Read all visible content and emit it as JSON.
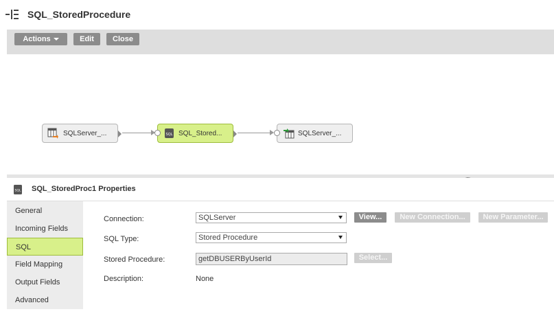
{
  "header": {
    "title": "SQL_StoredProcedure"
  },
  "toolbar": {
    "actions_label": "Actions",
    "edit_label": "Edit",
    "close_label": "Close"
  },
  "canvas": {
    "nodes": [
      {
        "label": "SQLServer_...",
        "icon": "source-table-icon"
      },
      {
        "label": "SQL_Stored...",
        "icon": "sql-database-icon"
      },
      {
        "label": "SQLServer_...",
        "icon": "target-table-icon"
      }
    ],
    "splitter_grip": "....."
  },
  "properties": {
    "title": "SQL_StoredProc1 Properties",
    "icon": "sql-database-icon",
    "tabs": [
      {
        "label": "General"
      },
      {
        "label": "Incoming Fields"
      },
      {
        "label": "SQL",
        "active": true
      },
      {
        "label": "Field Mapping"
      },
      {
        "label": "Output Fields"
      },
      {
        "label": "Advanced"
      }
    ],
    "form": {
      "connection_label": "Connection:",
      "connection_value": "SQLServer",
      "view_button": "View...",
      "new_connection_button": "New Connection...",
      "new_parameter_button": "New Parameter...",
      "sql_type_label": "SQL Type:",
      "sql_type_value": "Stored Procedure",
      "stored_procedure_label": "Stored Procedure:",
      "stored_procedure_value": "getDBUSERByUserId",
      "select_button": "Select...",
      "description_label": "Description:",
      "description_value": "None"
    }
  },
  "colors": {
    "selected_green": "#d8f08a",
    "button_gray": "#8c8c8c",
    "disabled_gray": "#cfcfcf"
  }
}
